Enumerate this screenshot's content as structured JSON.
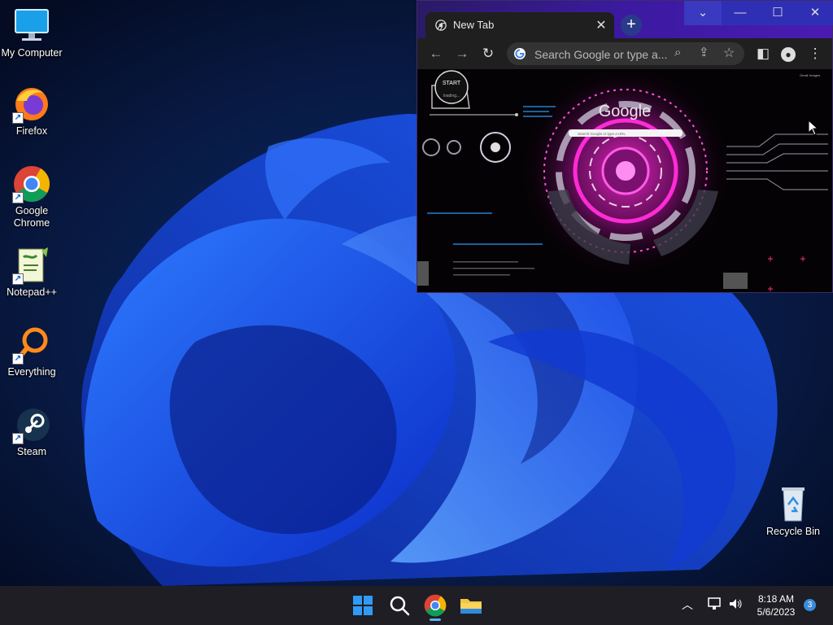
{
  "desktop": {
    "icons": [
      {
        "label": "My Computer"
      },
      {
        "label": "Firefox"
      },
      {
        "label": "Google Chrome"
      },
      {
        "label": "Notepad++"
      },
      {
        "label": "Everything"
      },
      {
        "label": "Steam"
      },
      {
        "label": "Recycle Bin"
      }
    ]
  },
  "browser": {
    "tab_title": "New Tab",
    "omnibox_placeholder": "Search Google or type a...",
    "page": {
      "logo_text": "Google",
      "start_label": "START",
      "loading_label": "loading...",
      "search_placeholder": "Search Google or type a URL",
      "top_links": [
        "Gmail",
        "Images"
      ]
    }
  },
  "taskbar": {
    "time": "8:18 AM",
    "date": "5/6/2023",
    "notification_count": "3"
  },
  "colors": {
    "wallpaper_bg": "#071634",
    "bloom_blue": "#1f5cf0",
    "titlebar": "#3b1aa0",
    "taskbar": "#1e1e24",
    "accent_pink": "#ff2bd6"
  }
}
